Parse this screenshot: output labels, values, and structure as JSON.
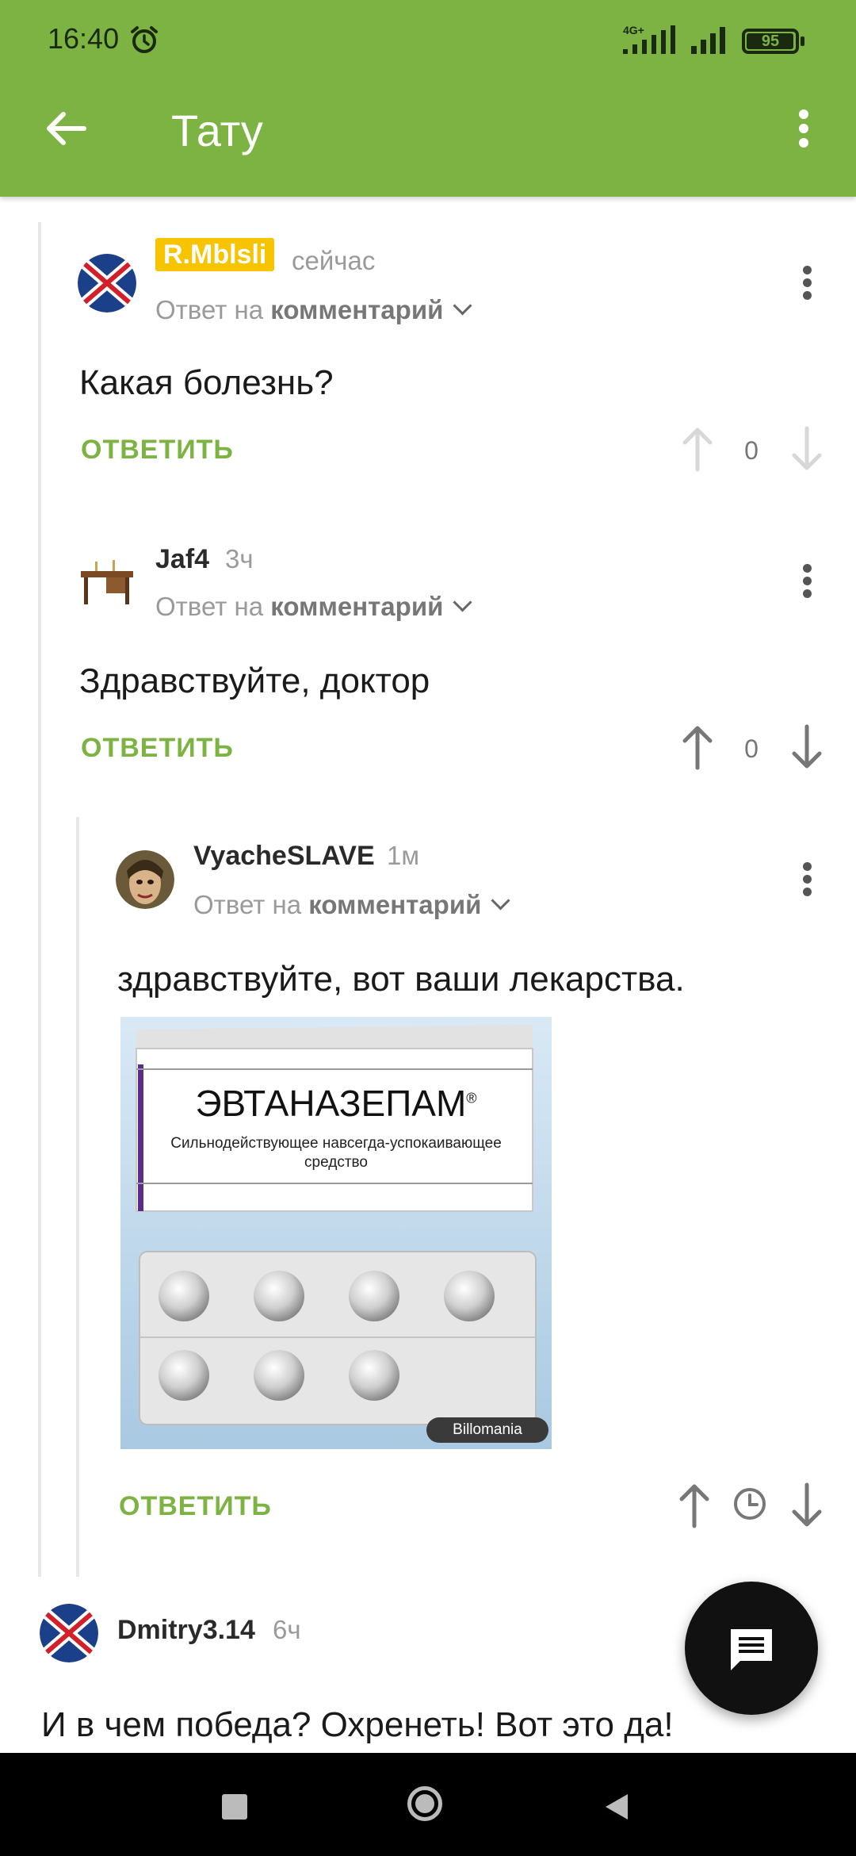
{
  "status_bar": {
    "time": "16:40",
    "network": "4G+",
    "battery": "95"
  },
  "app_bar": {
    "title": "Тату"
  },
  "comments": [
    {
      "author": "R.Mblsli",
      "time": "сейчас",
      "reply_prefix": "Ответ на",
      "reply_target": "комментарий",
      "text": "Какая болезнь?",
      "reply_label": "ОТВЕТИТЬ",
      "score": "0"
    },
    {
      "author": "Jaf4",
      "time": "3ч",
      "reply_prefix": "Ответ на",
      "reply_target": "комментарий",
      "text": "Здравствуйте, доктор",
      "reply_label": "ОТВЕТИТЬ",
      "score": "0"
    },
    {
      "author": "VyacheSLAVE",
      "time": "1м",
      "reply_prefix": "Ответ на",
      "reply_target": "комментарий",
      "text": "здравствуйте, вот ваши лекарства.",
      "reply_label": "ОТВЕТИТЬ",
      "image": {
        "brand": "ЭВТАНАЗЕПАМ",
        "reg_mark": "®",
        "subtitle_line1": "Сильнодействующее навсегда-успокаивающее",
        "subtitle_line2": "средство",
        "watermark": "Billomania"
      }
    },
    {
      "author": "Dmitry3.14",
      "time": "6ч",
      "text": "И в чем победа? Охренеть! Вот это да!"
    }
  ],
  "icons": {
    "back": "arrow-left-icon",
    "menu": "more-vert-icon",
    "upvote": "arrow-up-icon",
    "downvote": "arrow-down-icon",
    "pending": "clock-icon",
    "fab": "comment-icon"
  },
  "colors": {
    "accent": "#7cb342",
    "badge": "#f6c400"
  }
}
